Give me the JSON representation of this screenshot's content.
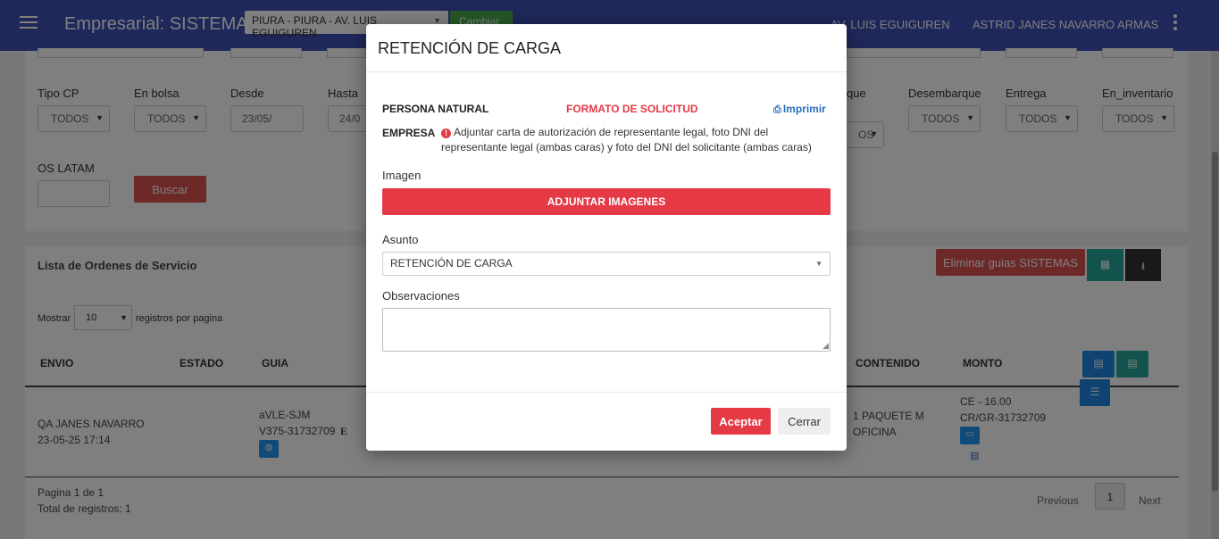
{
  "navbar": {
    "title": "Empresarial: SISTEMAS",
    "branch_selected": "PIURA - PIURA - AV. LUIS EGUIGUREN",
    "change_label": "Cambiar",
    "branch_short": "AV. LUIS EGUIGUREN",
    "user_name": "ASTRID JANES NAVARRO ARMAS"
  },
  "filters": {
    "tipo_cp": {
      "label": "Tipo CP",
      "value": "TODOS"
    },
    "en_bolsa": {
      "label": "En bolsa",
      "value": "TODOS"
    },
    "desde": {
      "label": "Desde",
      "value": "23/05/"
    },
    "hasta": {
      "label": "Hasta",
      "value": "24/0"
    },
    "embarque": {
      "label": "que",
      "value": "OS"
    },
    "desembarque": {
      "label": "Desembarque",
      "value": "TODOS"
    },
    "entrega": {
      "label": "Entrega",
      "value": "TODOS"
    },
    "en_inventario": {
      "label": "En_inventario",
      "value": "TODOS"
    },
    "os_latam": {
      "label": "OS LATAM",
      "value": ""
    },
    "search_label": "Buscar"
  },
  "list": {
    "title": "Lista de Ordenes de Servicio",
    "delete_label": "Eliminar guias SISTEMAS",
    "show_label": "Mostrar",
    "page_size": "10",
    "per_page_label": "registros por pagina",
    "headers": {
      "envio": "ENVIO",
      "estado": "ESTADO",
      "guia": "GUIA",
      "contenido": "CONTENIDO",
      "monto": "MONTO"
    },
    "row": {
      "envio_name": "QA JANES NAVARRO",
      "envio_date": "23-05-25 17:14",
      "guia_1": "aVLE-SJM",
      "guia_2": "V375-31732709",
      "guia_mark": "E",
      "contenido_1": "1 PAQUETE M",
      "contenido_2": "OFICINA",
      "monto_1": "CE - 16.00",
      "monto_2": "CR/GR-31732709"
    },
    "page_info": "Pagina 1 de 1",
    "total_info": "Total de registros: 1",
    "previous": "Previous",
    "current_page": "1",
    "next": "Next"
  },
  "modal": {
    "title": "RETENCIÓN DE CARGA",
    "persona_natural": "PERSONA NATURAL",
    "formato_link": "FORMATO DE SOLICITUD",
    "print_link": "Imprimir",
    "empresa": "EMPRESA",
    "empresa_desc_1": "Adjuntar carta de autorización de representante legal, foto DNI del",
    "empresa_desc_2": "representante legal (ambas caras) y foto del DNI del solicitante (ambas caras)",
    "imagen_label": "Imagen",
    "attach_label": "ADJUNTAR IMAGENES",
    "asunto_label": "Asunto",
    "asunto_value": "RETENCIÓN DE CARGA",
    "observaciones_label": "Observaciones",
    "observaciones_value": "",
    "accept_label": "Aceptar",
    "close_label": "Cerrar"
  },
  "colors": {
    "navbar": "#3f51b5",
    "primary_red": "#e53945",
    "link_blue": "#2a6ebb",
    "teal": "#26a69a"
  }
}
